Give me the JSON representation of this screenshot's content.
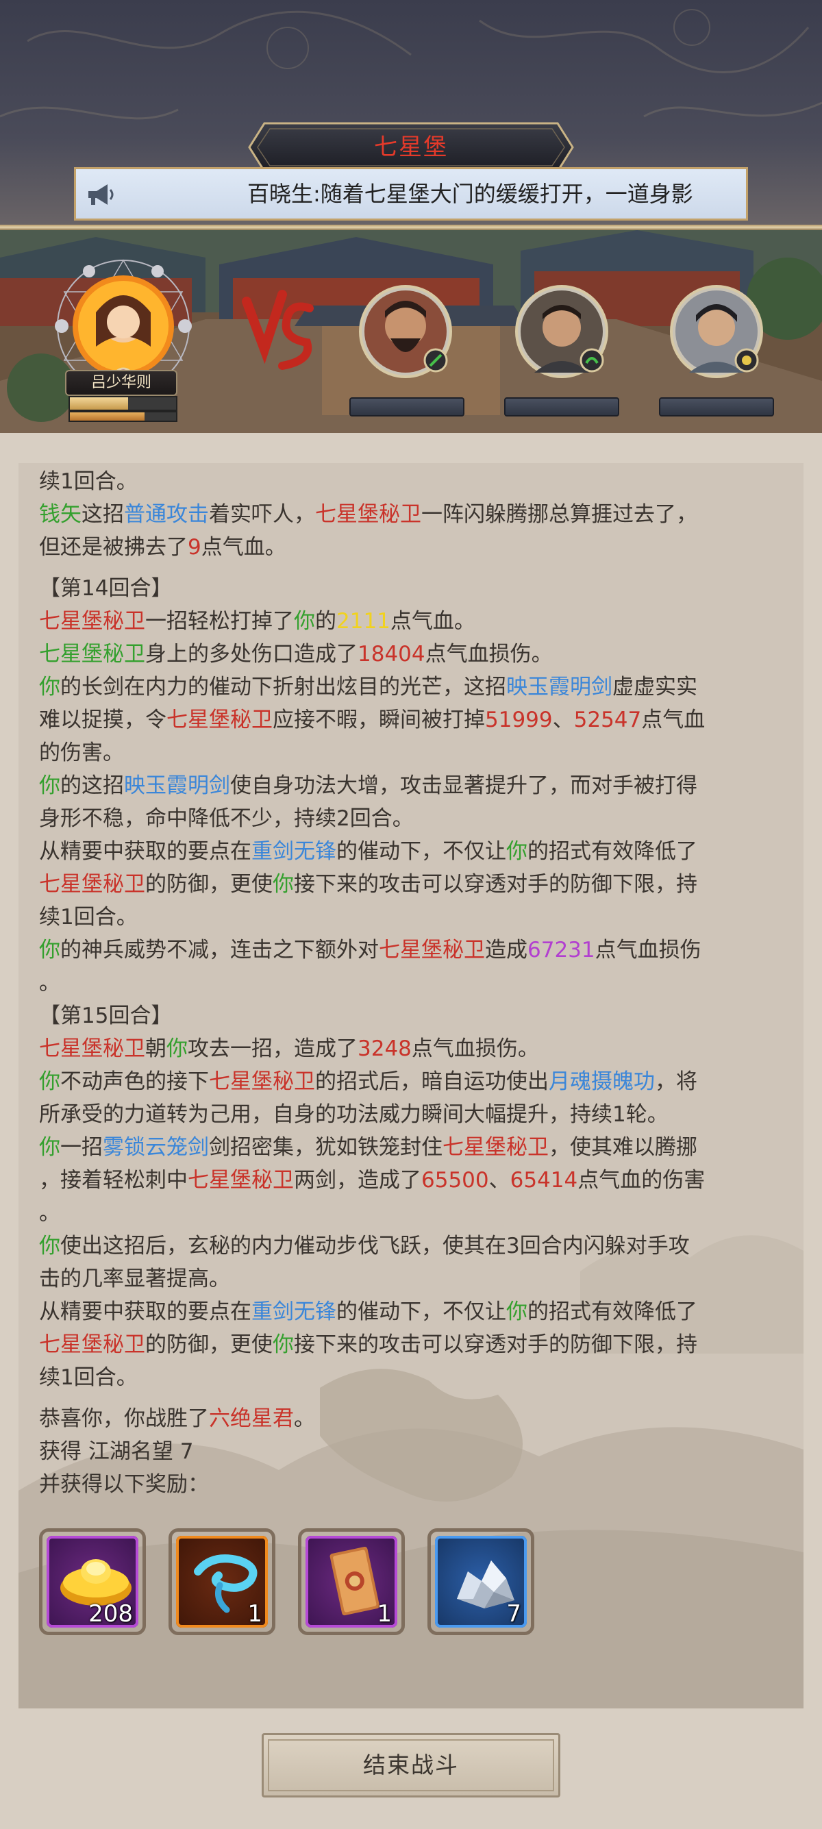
{
  "header": {
    "title": "七星堡",
    "notice": "百晓生:随着七星堡大门的缓缓打开，一道身影"
  },
  "battle": {
    "player_name": "吕少华则",
    "vs_label": "VS"
  },
  "log": {
    "l1": "续1回合。",
    "l2a": "钱矢",
    "l2b": "这招",
    "l2c": "普通攻击",
    "l2d": "着实吓人，",
    "l2e": "七星堡秘卫",
    "l2f": "一阵闪躲腾挪总算捱过去了，",
    "l3a": "但还是被拂去了",
    "l3b": "9",
    "l3c": "点气血。",
    "round14": "【第14回合】",
    "l4a": "七星堡秘卫",
    "l4b": "一招轻松打掉了",
    "l4c": "你",
    "l4d": "的",
    "l4e": "2111",
    "l4f": "点气血。",
    "l5a": "七星堡秘卫",
    "l5b": "身上的多处伤口造成了",
    "l5c": "18404",
    "l5d": "点气血损伤。",
    "l6a": "你",
    "l6b": "的长剑在内力的催动下折射出炫目的光芒，这招",
    "l6c": "映玉霞明剑",
    "l6d": "虚虚实实",
    "l7a": "难以捉摸，令",
    "l7b": "七星堡秘卫",
    "l7c": "应接不暇，瞬间被打掉",
    "l7d": "51999",
    "l7e": "、",
    "l7f": "52547",
    "l7g": "点气血",
    "l8": "的伤害。",
    "l9a": "你",
    "l9b": "的这招",
    "l9c": "映玉霞明剑",
    "l9d": "使自身功法大增，攻击显著提升了，而对手被打得",
    "l10": "身形不稳，命中降低不少，持续2回合。",
    "l11a": "从精要中获取的要点在",
    "l11b": "重剑无锋",
    "l11c": "的催动下，不仅让",
    "l11d": "你",
    "l11e": "的招式有效降低了",
    "l12a": "七星堡秘卫",
    "l12b": "的防御，更使",
    "l12c": "你",
    "l12d": "接下来的攻击可以穿透对手的防御下限，持",
    "l13": "续1回合。",
    "l14a": "你",
    "l14b": "的神兵威势不减，连击之下额外对",
    "l14c": "七星堡秘卫",
    "l14d": "造成",
    "l14e": "67231",
    "l14f": "点气血损伤",
    "l15": "。",
    "round15": "【第15回合】",
    "l16a": "七星堡秘卫",
    "l16b": "朝",
    "l16c": "你",
    "l16d": "攻去一招，造成了",
    "l16e": "3248",
    "l16f": "点气血损伤。",
    "l17a": "你",
    "l17b": "不动声色的接下",
    "l17c": "七星堡秘卫",
    "l17d": "的招式后，暗自运功使出",
    "l17e": "月魂摄魄功",
    "l17f": "，将",
    "l18": "所承受的力道转为己用，自身的功法威力瞬间大幅提升，持续1轮。",
    "l19a": "你",
    "l19b": "一招",
    "l19c": "雾锁云笼剑",
    "l19d": "剑招密集，犹如铁笼封住",
    "l19e": "七星堡秘卫",
    "l19f": "，使其难以腾挪",
    "l20a": "，接着轻松刺中",
    "l20b": "七星堡秘卫",
    "l20c": "两剑，造成了",
    "l20d": "65500",
    "l20e": "、",
    "l20f": "65414",
    "l20g": "点气血的伤害",
    "l21": "。",
    "l22a": "你",
    "l22b": "使出这招后，玄秘的内力催动步伐飞跃，使其在3回合内闪躲对手攻",
    "l23": "击的几率显著提高。",
    "l24a": "从精要中获取的要点在",
    "l24b": "重剑无锋",
    "l24c": "的催动下，不仅让",
    "l24d": "你",
    "l24e": "的招式有效降低了",
    "l25a": "七星堡秘卫",
    "l25b": "的防御，更使",
    "l25c": "你",
    "l25d": "接下来的攻击可以穿透对手的防御下限，持",
    "l26": "续1回合。",
    "l27a": "恭喜你，你战胜了",
    "l27b": "六绝星君",
    "l27c": "。",
    "obtain_label": "获得",
    "obtain_value": "江湖名望 7",
    "rewards_label": "并获得以下奖励："
  },
  "rewards": [
    {
      "icon": "gold-ingot-icon",
      "qty": "208",
      "frame": "#8a2ca6"
    },
    {
      "icon": "blue-swirl-icon",
      "qty": "1",
      "frame": "#d9761a"
    },
    {
      "icon": "envelope-scroll-icon",
      "qty": "1",
      "frame": "#8a2ca6"
    },
    {
      "icon": "crystal-ore-icon",
      "qty": "7",
      "frame": "#2f7bd6"
    }
  ],
  "footer": {
    "end_button": "结束战斗"
  },
  "colors": {
    "enemy_name": "#c9332a",
    "player": "#34a02e",
    "skill": "#3a86d9",
    "damage_in": "#f1d21e",
    "extra_damage": "#b23fd0"
  }
}
